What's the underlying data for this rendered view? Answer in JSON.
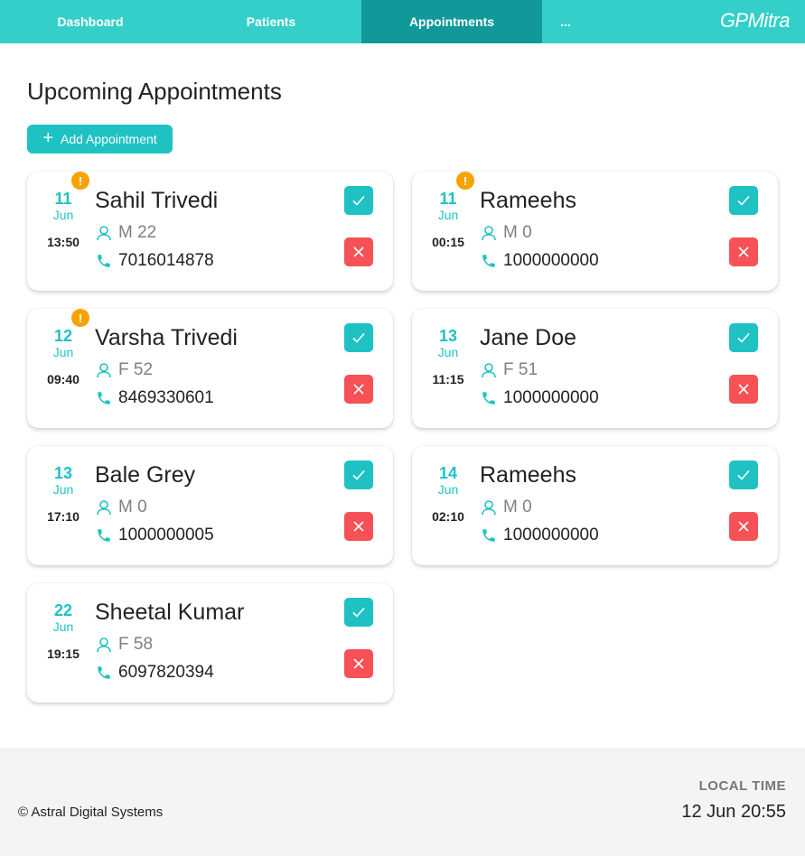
{
  "nav": {
    "items": [
      "Dashboard",
      "Patients",
      "Appointments",
      "..."
    ],
    "brand": "GPMitra"
  },
  "page": {
    "title": "Upcoming Appointments",
    "add_label": "Add Appointment"
  },
  "appointments": [
    {
      "day": "11",
      "month": "Jun",
      "time": "13:50",
      "name": "Sahil Trivedi",
      "info": "M 22",
      "phone": "7016014878",
      "alert": "!"
    },
    {
      "day": "11",
      "month": "Jun",
      "time": "00:15",
      "name": "Rameehs",
      "info": "M 0",
      "phone": "1000000000",
      "alert": "!"
    },
    {
      "day": "12",
      "month": "Jun",
      "time": "09:40",
      "name": "Varsha Trivedi",
      "info": "F 52",
      "phone": "8469330601",
      "alert": "!"
    },
    {
      "day": "13",
      "month": "Jun",
      "time": "11:15",
      "name": "Jane Doe",
      "info": "F 51",
      "phone": "1000000000",
      "alert": ""
    },
    {
      "day": "13",
      "month": "Jun",
      "time": "17:10",
      "name": "Bale Grey",
      "info": "M 0",
      "phone": "1000000005",
      "alert": ""
    },
    {
      "day": "14",
      "month": "Jun",
      "time": "02:10",
      "name": "Rameehs",
      "info": "M 0",
      "phone": "1000000000",
      "alert": ""
    },
    {
      "day": "22",
      "month": "Jun",
      "time": "19:15",
      "name": "Sheetal Kumar",
      "info": "F 58",
      "phone": "6097820394",
      "alert": ""
    }
  ],
  "footer": {
    "copyright": "© Astral Digital Systems",
    "local_time_label": "LOCAL TIME",
    "local_time_value": "12 Jun 20:55"
  },
  "colors": {
    "nav_bg": "#35cfc9",
    "nav_active": "#11999a",
    "accent": "#1fc2c2",
    "danger": "#f55156",
    "alert": "#f6a300"
  }
}
